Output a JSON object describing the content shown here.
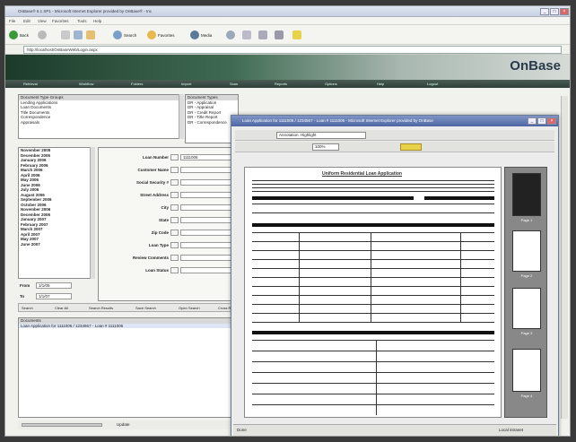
{
  "window": {
    "title": "OnBase® 6.1 SP1 - Microsoft Internet Explorer provided by OnBase® - Inc",
    "minimize": "_",
    "maximize": "□",
    "close": "×"
  },
  "menu": [
    "File",
    "Edit",
    "View",
    "Favorites",
    "Tools",
    "Help"
  ],
  "toolbar": {
    "back": "Back",
    "search": "Search",
    "favorites": "Favorites",
    "media": "Media"
  },
  "address": {
    "value": "http://localhost/OnBaseWeb/Login.aspx"
  },
  "brand": "OnBase",
  "nav": [
    "Retrieval",
    "Workflow",
    "Folders",
    "Import",
    "Scan",
    "Reports",
    "Options",
    "Help",
    "Logout"
  ],
  "doc_type_groups": {
    "header": "Document Type Groups",
    "items": [
      "Lending Applications",
      "Loan Documents",
      "Title Documents",
      "Correspondence",
      "Appraisals"
    ]
  },
  "doc_types": {
    "header": "Document Types",
    "items": [
      "DR - Application",
      "DR - Appraisal",
      "DR - Credit Report",
      "DR - Title Report",
      "DR - Correspondence"
    ]
  },
  "date_list": {
    "items": [
      "November 2005",
      "December 2005",
      "January 2006",
      "February 2006",
      "March 2006",
      "April 2006",
      "May 2006",
      "June 2006",
      "July 2006",
      "August 2006",
      "September 2006",
      "October 2006",
      "November 2006",
      "December 2006",
      "January 2007",
      "February 2007",
      "March 2007",
      "April 2007",
      "May 2007",
      "June 2007"
    ]
  },
  "date_from": {
    "label": "From",
    "value": "1/1/05"
  },
  "date_to": {
    "label": "To",
    "value": "1/1/07"
  },
  "keywords": [
    {
      "label": "Loan Number",
      "value": "1111006"
    },
    {
      "label": "Customer Name",
      "value": ""
    },
    {
      "label": "Social Security #",
      "value": ""
    },
    {
      "label": "Street Address",
      "value": ""
    },
    {
      "label": "City",
      "value": ""
    },
    {
      "label": "State",
      "value": ""
    },
    {
      "label": "Zip Code",
      "value": ""
    },
    {
      "label": "Loan Type",
      "value": ""
    },
    {
      "label": "Review Comments",
      "value": ""
    },
    {
      "label": "Loan Status",
      "value": ""
    }
  ],
  "buttons": [
    "Search",
    "Clear All",
    "Search Results",
    "Save Search",
    "Open Search",
    "Cross Ref"
  ],
  "results": {
    "header": "Documents",
    "items": [
      "Loan Application for 1111006 / 1234567 - Loan # 1111006"
    ]
  },
  "status": {
    "update": "Update"
  },
  "popup": {
    "title": "Loan Application for 1111006 / 1234567 - Loan # 1111006 - Microsoft Internet Explorer provided by OnBase",
    "highlight": "Annotation: Highlight",
    "zoom": "100%",
    "doc_title": "Uniform Residential Loan Application",
    "pages": [
      "Page 1",
      "Page 2",
      "Page 3",
      "Page 4"
    ],
    "footer": "Done",
    "zone": "Local intranet"
  },
  "colors": {
    "titlebar": "#4d66a3",
    "banner": "#1c3a2a",
    "accent": "#2a3a4a"
  }
}
